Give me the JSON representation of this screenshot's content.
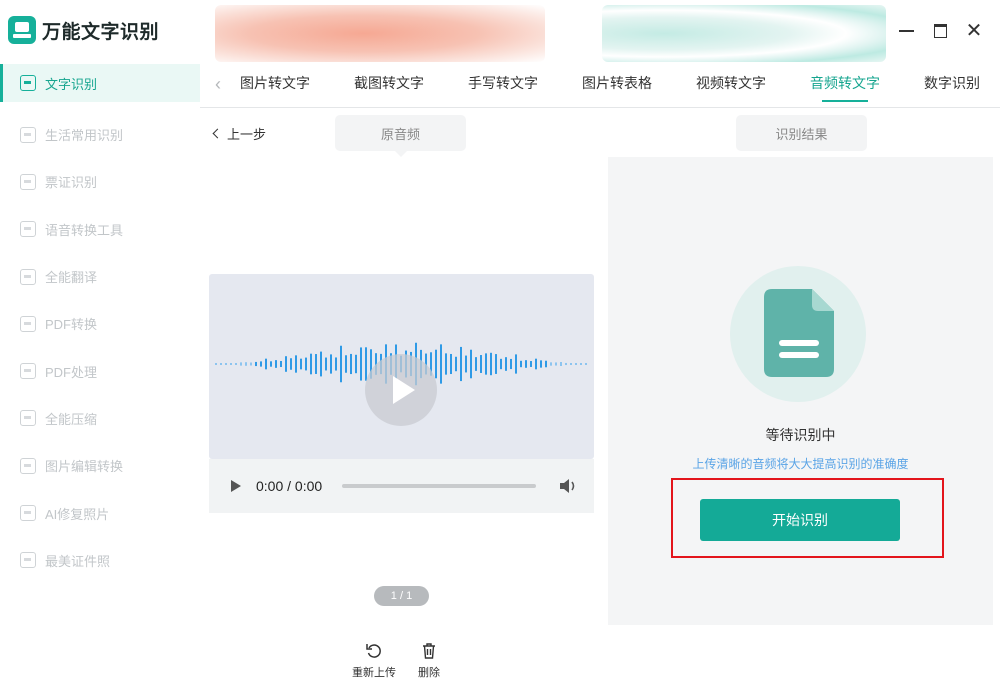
{
  "app": {
    "name": "万能文字识别",
    "brand_color": "#16b09a"
  },
  "sidebar": {
    "items": [
      {
        "label": "文字识别",
        "icon": "text-scan-icon",
        "active": true
      },
      {
        "label": "生活常用识别",
        "icon": "life-scan-icon"
      },
      {
        "label": "票证识别",
        "icon": "ticket-icon"
      },
      {
        "label": "语音转换工具",
        "icon": "voice-icon"
      },
      {
        "label": "全能翻译",
        "icon": "translate-icon"
      },
      {
        "label": "PDF转换",
        "icon": "pdf-convert-icon"
      },
      {
        "label": "PDF处理",
        "icon": "pdf-process-icon"
      },
      {
        "label": "全能压缩",
        "icon": "compress-icon"
      },
      {
        "label": "图片编辑转换",
        "icon": "image-edit-icon"
      },
      {
        "label": "AI修复照片",
        "icon": "ai-repair-icon"
      },
      {
        "label": "最美证件照",
        "icon": "id-photo-icon"
      }
    ]
  },
  "tabs": [
    {
      "label": "图片转文字"
    },
    {
      "label": "截图转文字"
    },
    {
      "label": "手写转文字"
    },
    {
      "label": "图片转表格"
    },
    {
      "label": "视频转文字"
    },
    {
      "label": "音频转文字",
      "active": true
    },
    {
      "label": "数字识别"
    }
  ],
  "left": {
    "back_label": "上一步",
    "source_label": "原音频",
    "audio_time": "0:00 / 0:00",
    "page_indicator": "1 / 1",
    "reupload_label": "重新上传",
    "delete_label": "删除"
  },
  "right": {
    "result_label": "识别结果",
    "status_title": "等待识别中",
    "hint": "上传清晰的音频将大大提高识别的准确度",
    "start_button": "开始识别",
    "highlight_color": "#e3151c"
  }
}
